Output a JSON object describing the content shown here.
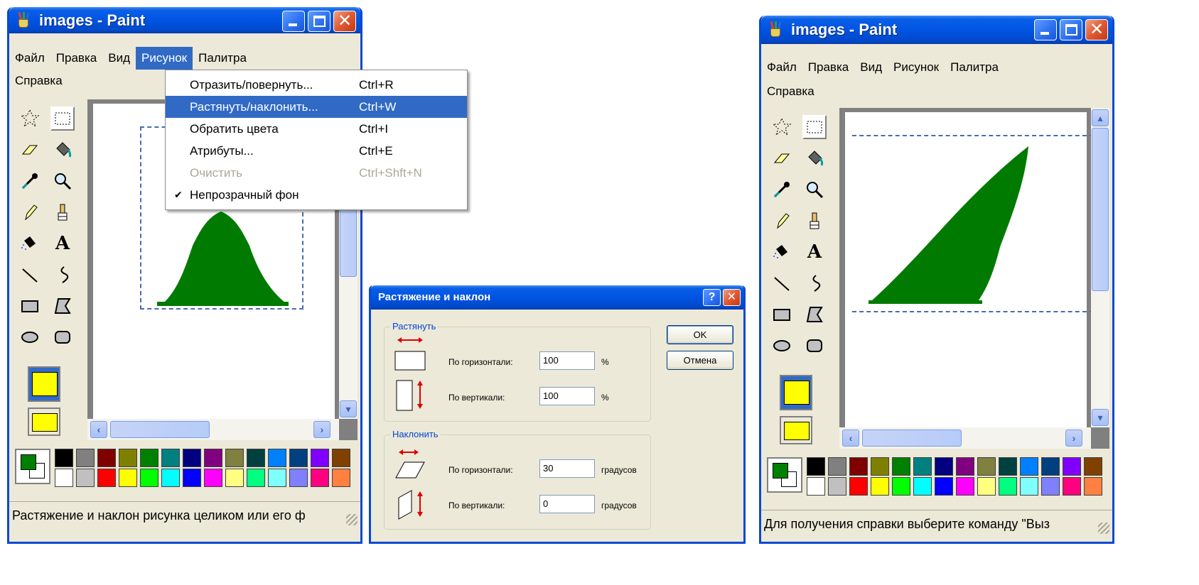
{
  "left_window": {
    "title": "images - Paint",
    "menu": [
      "Файл",
      "Правка",
      "Вид",
      "Рисунок",
      "Палитра",
      "Справка"
    ],
    "active_menu": "Рисунок",
    "status": "Растяжение и наклон рисунка целиком или его ф"
  },
  "picture_menu": {
    "items": [
      {
        "label": "Отразить/повернуть...",
        "shortcut": "Ctrl+R"
      },
      {
        "label": "Растянуть/наклонить...",
        "shortcut": "Ctrl+W"
      },
      {
        "label": "Обратить цвета",
        "shortcut": "Ctrl+I"
      },
      {
        "label": "Атрибуты...",
        "shortcut": "Ctrl+E"
      },
      {
        "label": "Очистить",
        "shortcut": "Ctrl+Shft+N"
      },
      {
        "label": "Непрозрачный фон",
        "shortcut": ""
      }
    ],
    "highlighted_index": 1,
    "disabled_index": 4,
    "checked_index": 5
  },
  "dialog": {
    "title": "Растяжение и наклон",
    "help_glyph": "?",
    "stretch": {
      "legend": "Растянуть",
      "horizontal_label": "По горизонтали:",
      "horizontal_value": "100",
      "horizontal_unit": "%",
      "vertical_label": "По вертикали:",
      "vertical_value": "100",
      "vertical_unit": "%"
    },
    "skew": {
      "legend": "Наклонить",
      "horizontal_label": "По горизонтали:",
      "horizontal_value": "30",
      "horizontal_unit": "градусов",
      "vertical_label": "По вертикали:",
      "vertical_value": "0",
      "vertical_unit": "градусов"
    },
    "ok_label": "OK",
    "cancel_label": "Отмена"
  },
  "right_window": {
    "title": "images - Paint",
    "menu": [
      "Файл",
      "Правка",
      "Вид",
      "Рисунок",
      "Палитра",
      "Справка"
    ],
    "status": "Для получения справки выберите команду \"Выз"
  },
  "colors": {
    "titlebar": "#0054e3",
    "highlight": "#316ac5",
    "tree_green": "#007a00",
    "palette_top": [
      "#000000",
      "#808080",
      "#800000",
      "#808000",
      "#008000",
      "#008080",
      "#000080",
      "#800080",
      "#808040",
      "#004040",
      "#0080ff",
      "#004080",
      "#8000ff",
      "#804000"
    ],
    "palette_bottom": [
      "#ffffff",
      "#c0c0c0",
      "#ff0000",
      "#ffff00",
      "#00ff00",
      "#00ffff",
      "#0000ff",
      "#ff00ff",
      "#ffff80",
      "#00ff80",
      "#80ffff",
      "#8080ff",
      "#ff0080",
      "#ff8040"
    ]
  },
  "tools": [
    "free-select-icon",
    "rect-select-icon",
    "eraser-icon",
    "fill-bucket-icon",
    "color-picker-icon",
    "magnifier-icon",
    "pencil-icon",
    "brush-icon",
    "airbrush-icon",
    "text-icon",
    "line-icon",
    "curve-icon",
    "rectangle-icon",
    "polygon-icon",
    "ellipse-icon",
    "rounded-rect-icon"
  ]
}
